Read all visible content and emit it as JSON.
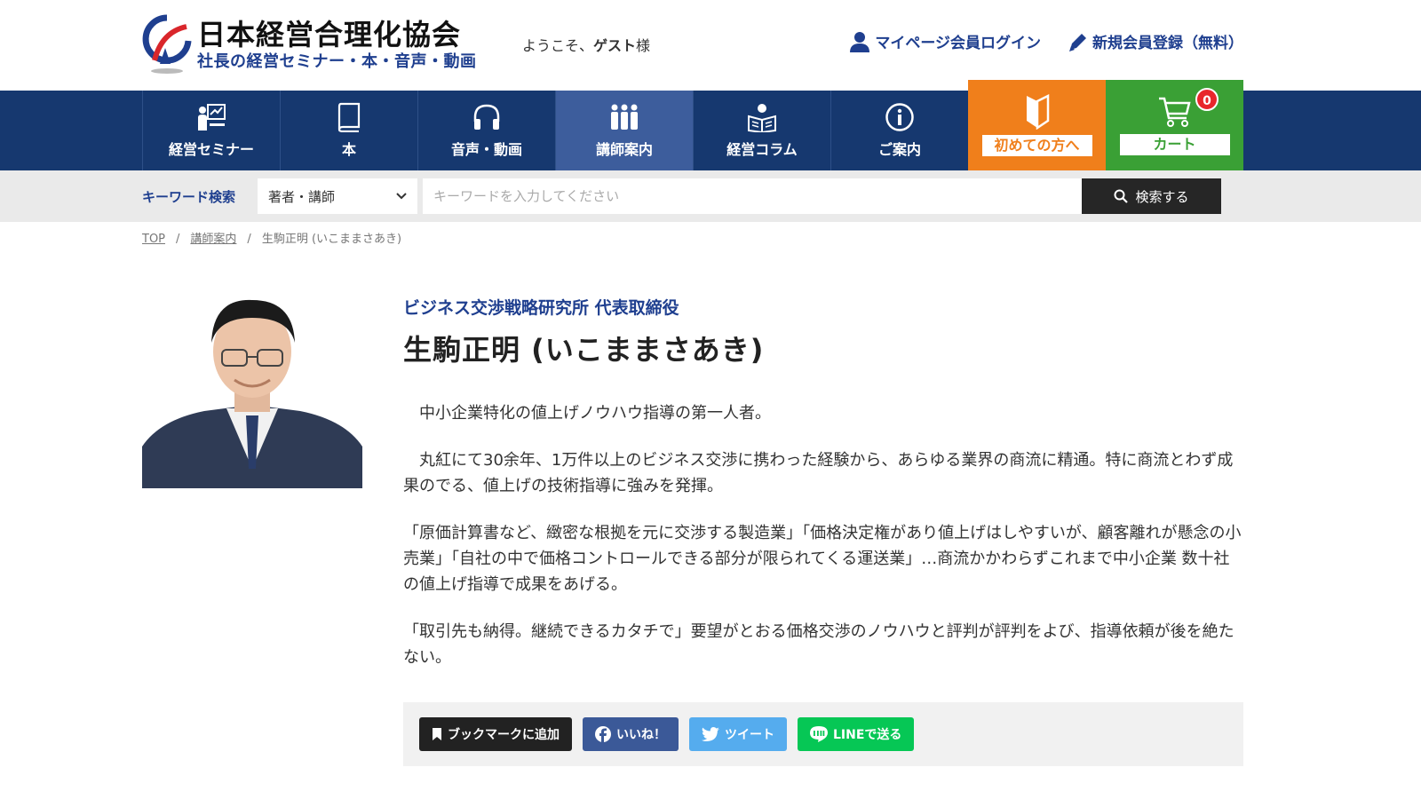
{
  "header": {
    "logo_title": "日本経営合理化協会",
    "logo_subtitle": "社長の経営セミナー・本・音声・動画",
    "welcome_prefix": "ようこそ、",
    "welcome_user": "ゲスト",
    "welcome_suffix": "様",
    "login_label": "マイページ会員ログイン",
    "register_label": "新規会員登録（無料）"
  },
  "nav": {
    "items": [
      {
        "label": "経営セミナー",
        "icon": "seminar-icon"
      },
      {
        "label": "本",
        "icon": "book-icon"
      },
      {
        "label": "音声・動画",
        "icon": "headphones-icon"
      },
      {
        "label": "講師案内",
        "icon": "people-icon"
      },
      {
        "label": "経営コラム",
        "icon": "reading-icon"
      },
      {
        "label": "ご案内",
        "icon": "info-icon"
      }
    ],
    "beginner_label": "初めての方へ",
    "cart_label": "カート",
    "cart_count": "0"
  },
  "search": {
    "label": "キーワード検索",
    "select_value": "著者・講師",
    "placeholder": "キーワードを入力してください",
    "button_label": "検索する"
  },
  "breadcrumb": {
    "top": "TOP",
    "section": "講師案内",
    "current": "生駒正明 (いこままさあき)"
  },
  "profile": {
    "org": "ビジネス交渉戦略研究所 代表取締役",
    "name": "生駒正明 (いこままさあき)",
    "bio": [
      "　中小企業特化の値上げノウハウ指導の第一人者。",
      "　丸紅にて30余年、1万件以上のビジネス交渉に携わった経験から、あらゆる業界の商流に精通。特に商流とわず成果のでる、値上げの技術指導に強みを発揮。",
      "「原価計算書など、緻密な根拠を元に交渉する製造業」「価格決定権があり値上げはしやすいが、顧客離れが懸念の小売業」「自社の中で価格コントロールできる部分が限られてくる運送業」…商流かかわらずこれまで中小企業 数十社の値上げ指導で成果をあげる。",
      "「取引先も納得。継続できるカタチで」要望がとおる価格交渉のノウハウと評判が評判をよび、指導依頼が後を絶たない。"
    ]
  },
  "share": {
    "bookmark": "ブックマークに追加",
    "facebook": "いいね！",
    "twitter": "ツイート",
    "line": "LINEで送る"
  },
  "colors": {
    "navy": "#16386f",
    "active_nav": "#3d5d9c",
    "orange": "#f07f1b",
    "green": "#3aa035",
    "accent_blue": "#1f3f8f"
  }
}
